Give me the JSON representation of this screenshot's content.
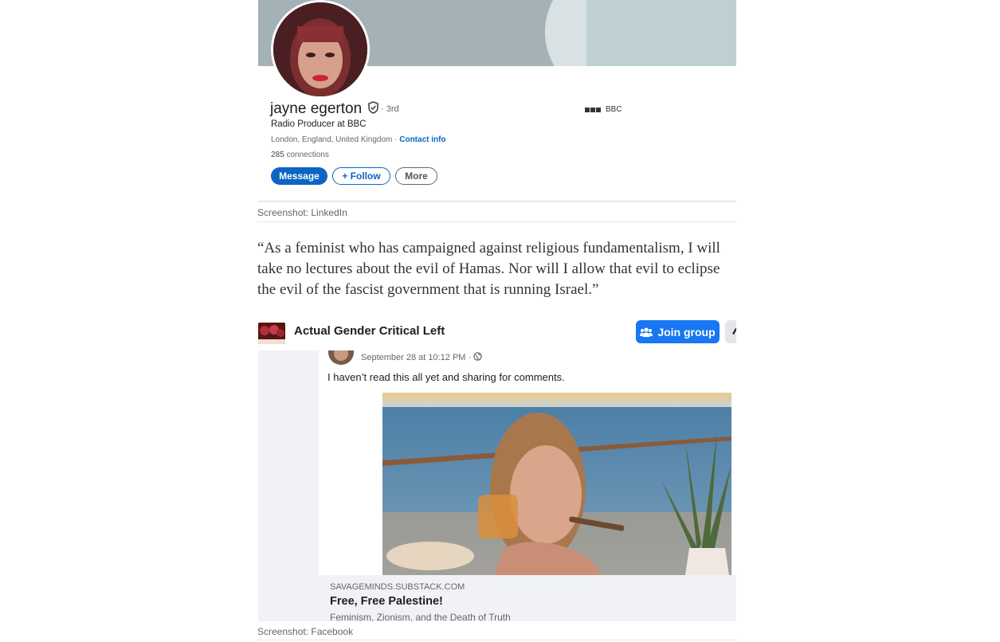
{
  "linkedin": {
    "name": "jayne egerton",
    "degree": "· 3rd",
    "headline": "Radio Producer at BBC",
    "location": "London, England, United Kingdom ·",
    "contact_info": "Contact info",
    "connections_count": "285",
    "connections_label": "connections",
    "buttons": {
      "message": "Message",
      "follow": "+ Follow",
      "more": "More"
    },
    "company": "BBC",
    "icons": {
      "verified": "verified-shield-icon",
      "company_logo": "bbc-logo-icon"
    },
    "colors": {
      "accent": "#0a66c2"
    }
  },
  "caption_linkedin": "Screenshot: LinkedIn",
  "quote": "“As a feminist who has campaigned against religious fundamentalism, I will take no lectures about the evil of Hamas. Nor will I allow that evil to eclipse the evil of the fascist government that is running Israel.”",
  "facebook": {
    "group_name": "Actual Gender Critical Left",
    "join_button": "Join group",
    "post_time": "September 28 at 10:12 PM ·",
    "post_text": "I haven’t read this all yet and sharing for comments.",
    "link_domain": "SAVAGEMINDS.SUBSTACK.COM",
    "link_title": "Free, Free Palestine!",
    "link_subtitle": "Feminism, Zionism, and the Death of Truth",
    "icons": {
      "join": "group-icon",
      "privacy": "globe-icon"
    },
    "colors": {
      "accent": "#1877f2"
    }
  },
  "caption_facebook": "Screenshot: Facebook"
}
